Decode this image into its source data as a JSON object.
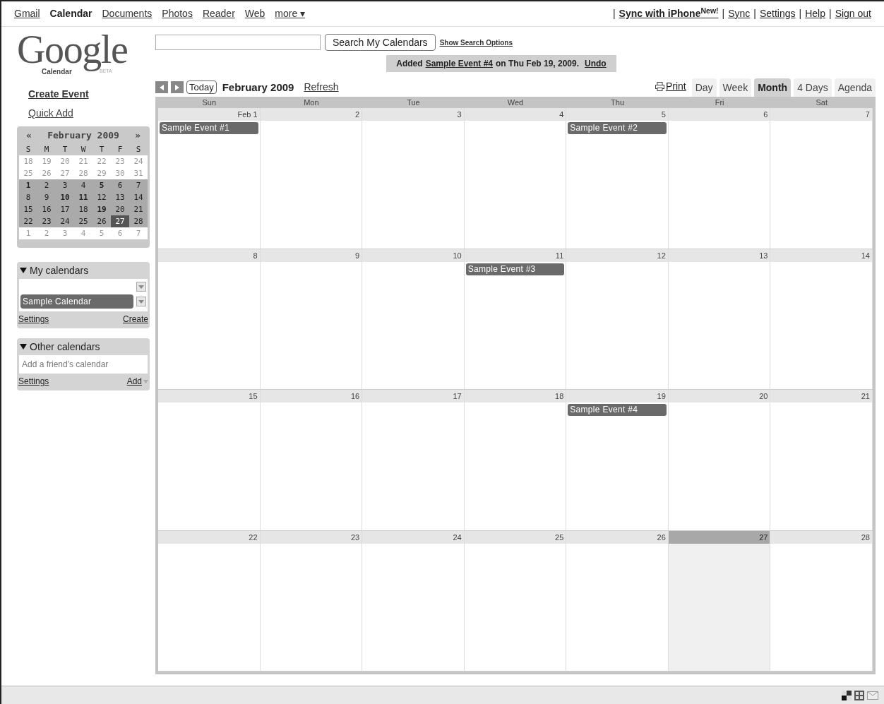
{
  "top_nav": {
    "apps": [
      {
        "label": "Gmail",
        "selected": false
      },
      {
        "label": "Calendar",
        "selected": true
      },
      {
        "label": "Documents",
        "selected": false
      },
      {
        "label": "Photos",
        "selected": false
      },
      {
        "label": "Reader",
        "selected": false
      },
      {
        "label": "Web",
        "selected": false
      },
      {
        "label": "more ▾",
        "selected": false
      }
    ],
    "separator": "|",
    "links": [
      {
        "label": "Sync with iPhone$^{New!}$",
        "bold": true
      },
      {
        "label": "Sync",
        "bold": false
      },
      {
        "label": "Settings",
        "bold": false
      },
      {
        "label": "Help",
        "bold": false
      },
      {
        "label": "Sign out",
        "bold": false
      }
    ]
  },
  "logo": {
    "word": "Google",
    "product": "Calendar",
    "tag": "BETA"
  },
  "search": {
    "button": "Search My Calendars",
    "options_link": "Show Search Options"
  },
  "notice": {
    "prefix": "Added",
    "event_link": "Sample Event #4",
    "suffix": "on Thu Feb 19, 2009.",
    "undo": "Undo"
  },
  "sidebar": {
    "create_event": "Create Event",
    "quick_add": "Quick Add",
    "mini_calendar": {
      "prev": "«",
      "title": "February 2009",
      "next": "»",
      "weekdays": [
        "S",
        "M",
        "T",
        "W",
        "T",
        "F",
        "S"
      ],
      "weeks": [
        [
          {
            "d": "18",
            "other": true,
            "bold": false,
            "selected": false
          },
          {
            "d": "19",
            "other": true,
            "bold": false,
            "selected": false
          },
          {
            "d": "20",
            "other": true,
            "bold": false,
            "selected": false
          },
          {
            "d": "21",
            "other": true,
            "bold": false,
            "selected": false
          },
          {
            "d": "22",
            "other": true,
            "bold": false,
            "selected": false
          },
          {
            "d": "23",
            "other": true,
            "bold": false,
            "selected": false
          },
          {
            "d": "24",
            "other": true,
            "bold": false,
            "selected": false
          }
        ],
        [
          {
            "d": "25",
            "other": true,
            "bold": false,
            "selected": false
          },
          {
            "d": "26",
            "other": true,
            "bold": false,
            "selected": false
          },
          {
            "d": "27",
            "other": true,
            "bold": false,
            "selected": false
          },
          {
            "d": "28",
            "other": true,
            "bold": false,
            "selected": false
          },
          {
            "d": "29",
            "other": true,
            "bold": false,
            "selected": false
          },
          {
            "d": "30",
            "other": true,
            "bold": false,
            "selected": false
          },
          {
            "d": "31",
            "other": true,
            "bold": false,
            "selected": false
          }
        ],
        [
          {
            "d": "1",
            "other": false,
            "bold": true,
            "selected": false
          },
          {
            "d": "2",
            "other": false,
            "bold": false,
            "selected": false
          },
          {
            "d": "3",
            "other": false,
            "bold": false,
            "selected": false
          },
          {
            "d": "4",
            "other": false,
            "bold": false,
            "selected": false
          },
          {
            "d": "5",
            "other": false,
            "bold": true,
            "selected": false
          },
          {
            "d": "6",
            "other": false,
            "bold": false,
            "selected": false
          },
          {
            "d": "7",
            "other": false,
            "bold": false,
            "selected": false
          }
        ],
        [
          {
            "d": "8",
            "other": false,
            "bold": false,
            "selected": false
          },
          {
            "d": "9",
            "other": false,
            "bold": false,
            "selected": false
          },
          {
            "d": "10",
            "other": false,
            "bold": true,
            "selected": false
          },
          {
            "d": "11",
            "other": false,
            "bold": true,
            "selected": false
          },
          {
            "d": "12",
            "other": false,
            "bold": false,
            "selected": false
          },
          {
            "d": "13",
            "other": false,
            "bold": false,
            "selected": false
          },
          {
            "d": "14",
            "other": false,
            "bold": false,
            "selected": false
          }
        ],
        [
          {
            "d": "15",
            "other": false,
            "bold": false,
            "selected": false
          },
          {
            "d": "16",
            "other": false,
            "bold": false,
            "selected": false
          },
          {
            "d": "17",
            "other": false,
            "bold": false,
            "selected": false
          },
          {
            "d": "18",
            "other": false,
            "bold": false,
            "selected": false
          },
          {
            "d": "19",
            "other": false,
            "bold": true,
            "selected": false
          },
          {
            "d": "20",
            "other": false,
            "bold": false,
            "selected": false
          },
          {
            "d": "21",
            "other": false,
            "bold": false,
            "selected": false
          }
        ],
        [
          {
            "d": "22",
            "other": false,
            "bold": false,
            "selected": false
          },
          {
            "d": "23",
            "other": false,
            "bold": false,
            "selected": false
          },
          {
            "d": "24",
            "other": false,
            "bold": false,
            "selected": false
          },
          {
            "d": "25",
            "other": false,
            "bold": false,
            "selected": false
          },
          {
            "d": "26",
            "other": false,
            "bold": false,
            "selected": false
          },
          {
            "d": "27",
            "other": false,
            "bold": false,
            "selected": true
          },
          {
            "d": "28",
            "other": false,
            "bold": false,
            "selected": false
          }
        ],
        [
          {
            "d": "1",
            "other": true,
            "bold": false,
            "selected": false
          },
          {
            "d": "2",
            "other": true,
            "bold": false,
            "selected": false
          },
          {
            "d": "3",
            "other": true,
            "bold": false,
            "selected": false
          },
          {
            "d": "4",
            "other": true,
            "bold": false,
            "selected": false
          },
          {
            "d": "5",
            "other": true,
            "bold": false,
            "selected": false
          },
          {
            "d": "6",
            "other": true,
            "bold": false,
            "selected": false
          },
          {
            "d": "7",
            "other": true,
            "bold": false,
            "selected": false
          }
        ]
      ]
    },
    "my_calendars": {
      "title": "My calendars",
      "expanded": true,
      "calendars": [
        "Sample Calendar"
      ],
      "settings": "Settings",
      "create": "Create"
    },
    "other_calendars": {
      "title": "Other calendars",
      "expanded": true,
      "placeholder": "Add a friend's calendar",
      "settings": "Settings",
      "add": "Add"
    }
  },
  "toolbar": {
    "today": "Today",
    "title": "February 2009",
    "refresh": "Refresh",
    "print": "Print",
    "views": [
      {
        "label": "Day",
        "selected": false
      },
      {
        "label": "Week",
        "selected": false
      },
      {
        "label": "Month",
        "selected": true
      },
      {
        "label": "4 Days",
        "selected": false
      },
      {
        "label": "Agenda",
        "selected": false
      }
    ]
  },
  "month": {
    "weekdays": [
      "Sun",
      "Mon",
      "Tue",
      "Wed",
      "Thu",
      "Fri",
      "Sat"
    ],
    "weeks": [
      [
        {
          "date": "Feb 1",
          "today": false,
          "events": [
            "Sample Event #1"
          ]
        },
        {
          "date": "2",
          "today": false
        },
        {
          "date": "3",
          "today": false
        },
        {
          "date": "4",
          "today": false
        },
        {
          "date": "5",
          "today": false,
          "events": [
            "Sample Event #2"
          ]
        },
        {
          "date": "6",
          "today": false
        },
        {
          "date": "7",
          "today": false
        }
      ],
      [
        {
          "date": "8",
          "today": false
        },
        {
          "date": "9",
          "today": false
        },
        {
          "date": "10",
          "today": false
        },
        {
          "date": "11",
          "today": false,
          "events": [
            "Sample Event #3"
          ]
        },
        {
          "date": "12",
          "today": false
        },
        {
          "date": "13",
          "today": false
        },
        {
          "date": "14",
          "today": false
        }
      ],
      [
        {
          "date": "15",
          "today": false
        },
        {
          "date": "16",
          "today": false
        },
        {
          "date": "17",
          "today": false
        },
        {
          "date": "18",
          "today": false
        },
        {
          "date": "19",
          "today": false,
          "events": [
            "Sample Event #4"
          ]
        },
        {
          "date": "20",
          "today": false
        },
        {
          "date": "21",
          "today": false
        }
      ],
      [
        {
          "date": "22",
          "today": false
        },
        {
          "date": "23",
          "today": false
        },
        {
          "date": "24",
          "today": false
        },
        {
          "date": "25",
          "today": false
        },
        {
          "date": "26",
          "today": false
        },
        {
          "date": "27",
          "today": true
        },
        {
          "date": "28",
          "today": false
        }
      ]
    ]
  }
}
